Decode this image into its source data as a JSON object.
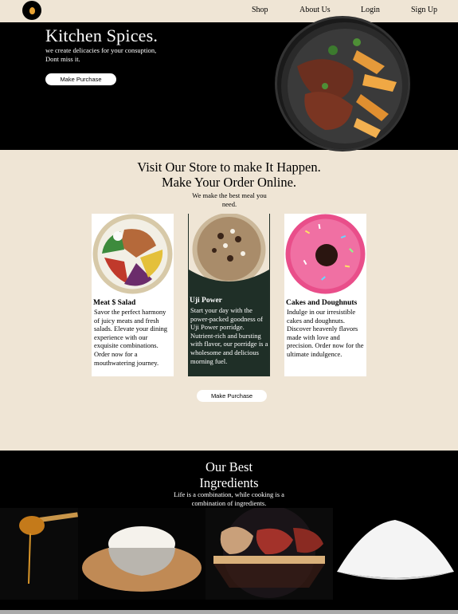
{
  "nav": {
    "links": [
      "Shop",
      "About Us",
      "Login",
      "Sign Up"
    ]
  },
  "hero": {
    "title": "Kitchen Spices.",
    "tagline": "we create delicacies for your consuption, Dont miss it.",
    "cta": "Make Purchase"
  },
  "store": {
    "heading_line1": "Visit Our Store to make It Happen.",
    "heading_line2": "Make Your Order Online.",
    "subtext": "We make the best meal you need.",
    "cards": [
      {
        "title": "Meat $ Salad",
        "text": "Savor the perfect harmony of juicy meats and fresh salads. Elevate your dining experience with our exquisite combinations. Order now for a mouthwatering journey."
      },
      {
        "title": "Uji Power",
        "text": "Start your day with the power-packed goodness of Uji Power porridge. Nutrient-rich and bursting with flavor, our porridge is a wholesome and delicious morning fuel."
      },
      {
        "title": "Cakes and Doughnuts",
        "text": "Indulge in our irresistible cakes and doughnuts. Discover heavenly flavors made with love and precision. Order now for the ultimate indulgence."
      }
    ],
    "cta": "Make Purchase"
  },
  "ingredients": {
    "heading_line1": "Our Best",
    "heading_line2": "Ingredients",
    "subtext": "Life is a combination, while cooking is a combination of ingredients."
  },
  "colors": {
    "cream": "#efe5d5",
    "black": "#000000",
    "card_dark": "#1f2f27",
    "logo_accent": "#e7a233"
  }
}
